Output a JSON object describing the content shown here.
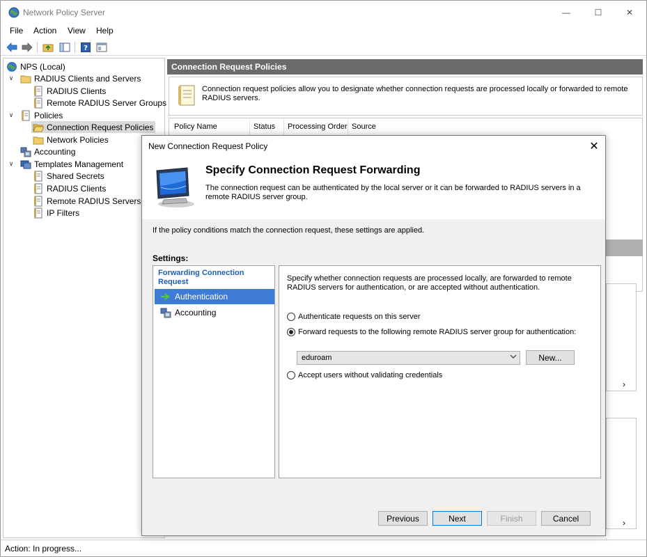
{
  "window": {
    "title": "Network Policy Server",
    "controls": [
      "—",
      "☐",
      "✕"
    ]
  },
  "menu": [
    "File",
    "Action",
    "View",
    "Help"
  ],
  "tree": {
    "items": [
      {
        "label": "NPS (Local)",
        "icon": "nps-globe-icon",
        "expander": ""
      },
      {
        "label": "RADIUS Clients and Servers",
        "icon": "folder-icon",
        "expander": "∨"
      },
      {
        "label": "RADIUS Clients",
        "icon": "document-icon",
        "expander": ""
      },
      {
        "label": "Remote RADIUS Server Groups",
        "icon": "document-icon",
        "expander": ""
      },
      {
        "label": "Policies",
        "icon": "document-icon",
        "expander": "∨"
      },
      {
        "label": "Connection Request Policies",
        "icon": "folder-open-icon",
        "expander": ""
      },
      {
        "label": "Network Policies",
        "icon": "folder-icon",
        "expander": ""
      },
      {
        "label": "Accounting",
        "icon": "accounting-icon",
        "expander": ""
      },
      {
        "label": "Templates Management",
        "icon": "templates-icon",
        "expander": "∨"
      },
      {
        "label": "Shared Secrets",
        "icon": "document-icon",
        "expander": ""
      },
      {
        "label": "RADIUS Clients",
        "icon": "document-icon",
        "expander": ""
      },
      {
        "label": "Remote RADIUS Servers",
        "icon": "document-icon",
        "expander": ""
      },
      {
        "label": "IP Filters",
        "icon": "document-icon",
        "expander": ""
      }
    ]
  },
  "right_pane": {
    "header": "Connection Request Policies",
    "info": "Connection request policies allow you to designate whether connection requests are processed locally or forwarded to remote RADIUS servers.",
    "columns": [
      "Policy Name",
      "Status",
      "Processing Order",
      "Source"
    ]
  },
  "status": {
    "text": "Action:  In progress..."
  },
  "dialog": {
    "title": "New Connection Request Policy",
    "close": "✕",
    "heading": "Specify Connection Request Forwarding",
    "subheading": "The connection request can be authenticated by the local server or it can be forwarded to RADIUS servers in a remote RADIUS server group.",
    "condition_text": "If the policy conditions match the connection request, these settings are applied.",
    "settings_label": "Settings:",
    "nav": {
      "category": "Forwarding Connection Request",
      "items": [
        {
          "label": "Authentication",
          "selected": true,
          "icon": "green-arrow-icon"
        },
        {
          "label": "Accounting",
          "selected": false,
          "icon": "accounting-icon"
        }
      ]
    },
    "content": {
      "description": "Specify whether connection requests are processed locally, are forwarded to remote RADIUS servers for authentication, or are accepted without authentication.",
      "options": [
        {
          "label": "Authenticate requests on this server",
          "checked": false
        },
        {
          "label": "Forward requests to the following remote RADIUS server group for authentication:",
          "checked": true
        },
        {
          "label": "Accept users without validating credentials",
          "checked": false
        }
      ],
      "server_group": "eduroam",
      "new_button": "New..."
    },
    "buttons": {
      "previous": "Previous",
      "next": "Next",
      "finish": "Finish",
      "cancel": "Cancel"
    }
  },
  "colors": {
    "header_bg": "#6b6b6b",
    "selection_blue": "#3d7bd6",
    "category_blue": "#1e5fb3",
    "dialog_body": "#f0f0f0"
  }
}
